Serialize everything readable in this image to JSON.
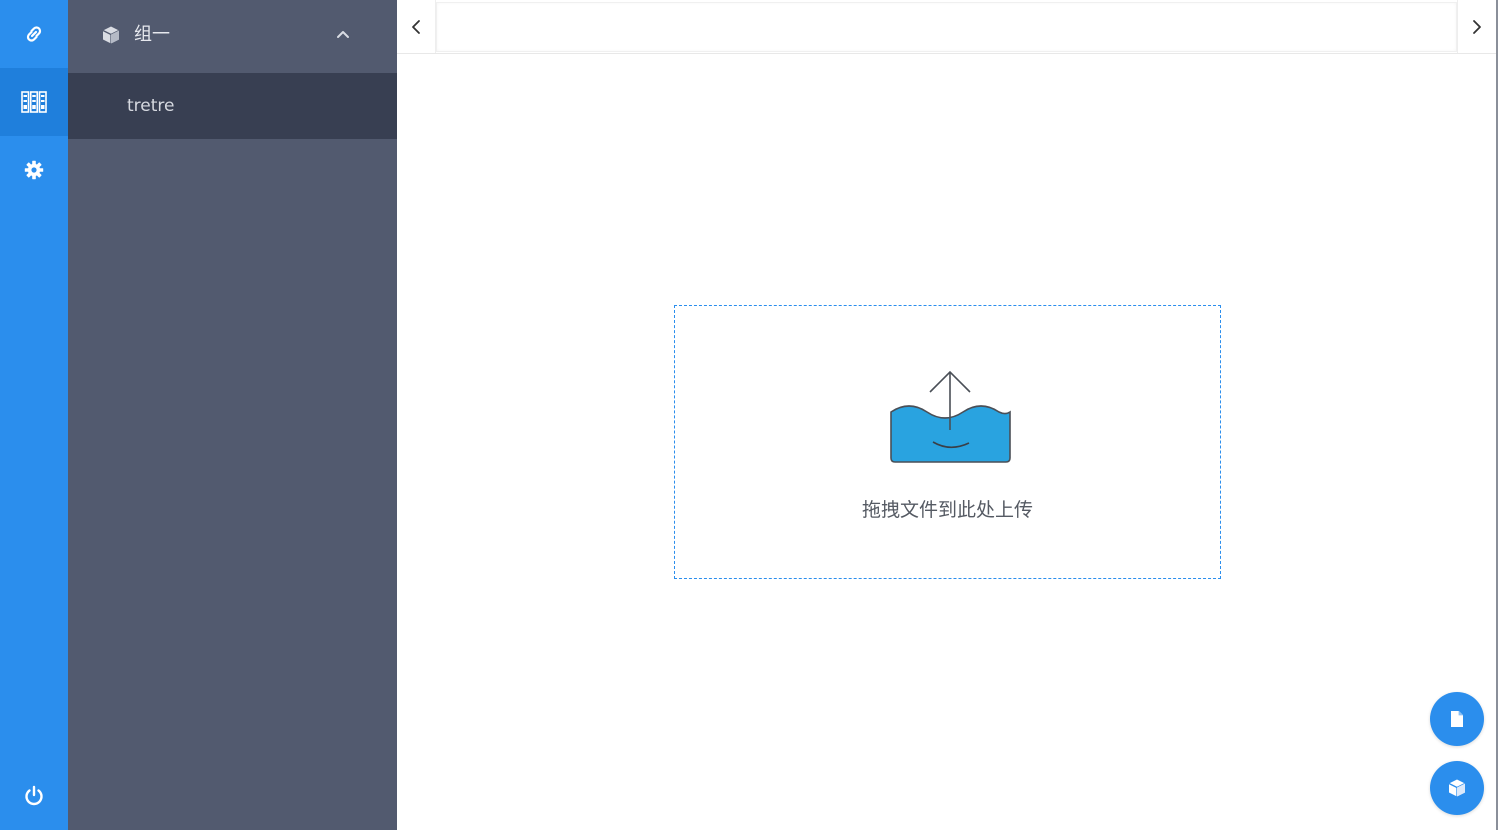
{
  "rail": {
    "items": [
      {
        "icon": "link-icon"
      },
      {
        "icon": "library-icon"
      },
      {
        "icon": "gear-icon"
      }
    ],
    "power_icon": "power-icon"
  },
  "sidebar": {
    "group": {
      "icon": "cube-icon",
      "title": "组一",
      "expanded": true,
      "items": [
        {
          "label": "tretre",
          "active": true
        }
      ]
    }
  },
  "tabs": {
    "prev_icon": "chevron-left-icon",
    "next_icon": "chevron-right-icon"
  },
  "dropzone": {
    "icon": "upload-icon",
    "text": "拖拽文件到此处上传"
  },
  "fabs": [
    {
      "icon": "file-icon"
    },
    {
      "icon": "cube-icon"
    }
  ],
  "colors": {
    "accent": "#2b8eed",
    "sidebar_bg": "#525a6f",
    "sidebar_active_bg": "#383f52",
    "water": "#29a3e0"
  }
}
